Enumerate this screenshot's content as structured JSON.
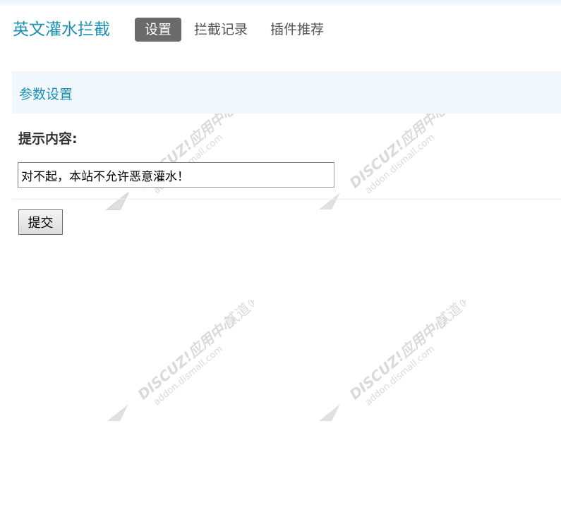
{
  "app": {
    "title": "英文灌水拦截"
  },
  "nav": {
    "tabs": [
      {
        "label": "设置",
        "active": true
      },
      {
        "label": "拦截记录",
        "active": false
      },
      {
        "label": "插件推荐",
        "active": false
      }
    ]
  },
  "section": {
    "title": "参数设置"
  },
  "form": {
    "prompt_label": "提示内容:",
    "prompt_value": "对不起，本站不允许恶意灌水！",
    "submit_label": "提交"
  },
  "watermark": {
    "line1": "DISCUZ!应用中心",
    "line2": "addon.dismall.com",
    "line3": "贰道®"
  },
  "colors": {
    "accent": "#1b8fb3",
    "active_tab_bg": "#6a6a6a",
    "section_bg": "#f0f7fd"
  }
}
